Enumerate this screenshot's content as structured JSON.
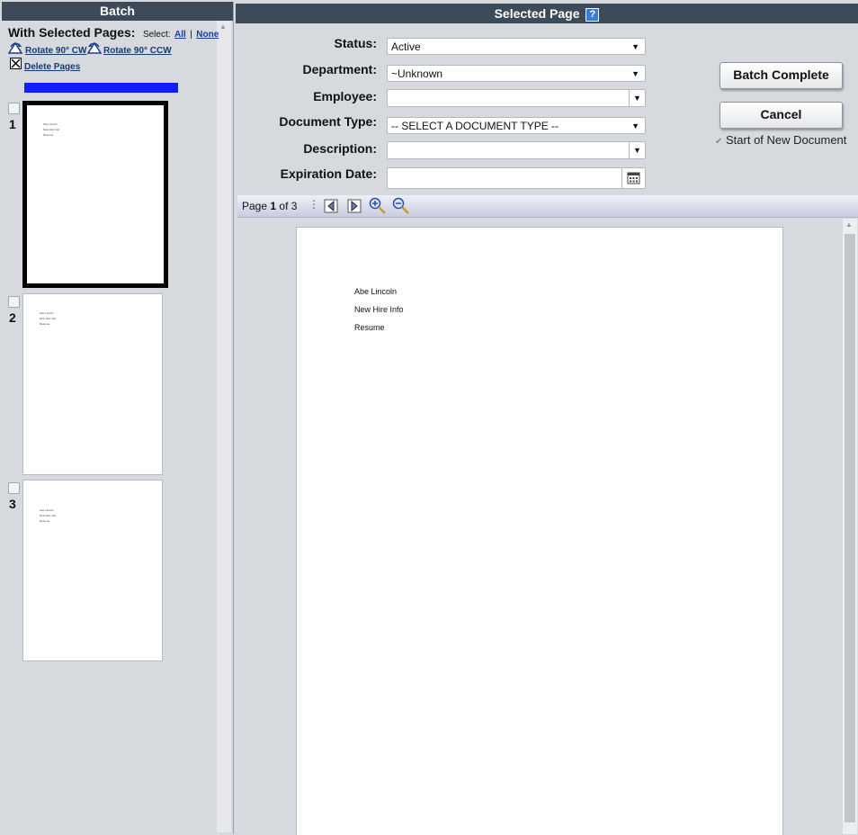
{
  "batch_panel": {
    "title": "Batch",
    "with_selected": "With Selected Pages:",
    "select_label": "Select:",
    "select_all": "All",
    "select_sep": "|",
    "select_none": "None",
    "rotate_cw": "Rotate 90° CW",
    "rotate_ccw": "Rotate 90° CCW",
    "delete_pages": "Delete Pages",
    "pages": [
      {
        "number": "1",
        "lines": [
          "Abe Lincoln",
          "New Hire Info",
          "Resume"
        ]
      },
      {
        "number": "2",
        "lines": [
          "Abe Lincoln",
          "New Hire Info",
          "Resume"
        ]
      },
      {
        "number": "3",
        "lines": [
          "Abe Lincoln",
          "New Hire Info",
          "Resume"
        ]
      }
    ]
  },
  "selected_page": {
    "title": "Selected Page",
    "help": "?",
    "fields": {
      "status_label": "Status:",
      "status_value": "Active",
      "department_label": "Department:",
      "department_value": "~Unknown",
      "employee_label": "Employee:",
      "employee_value": "",
      "document_type_label": "Document Type:",
      "document_type_value": "-- SELECT A DOCUMENT TYPE --",
      "description_label": "Description:",
      "description_value": "",
      "expiration_label": "Expiration Date:",
      "expiration_value": ""
    },
    "buttons": {
      "batch_complete": "Batch Complete",
      "cancel": "Cancel"
    },
    "start_new_document_label": "Start of New Document",
    "start_new_document_checked": true
  },
  "toolbar": {
    "page_prefix": "Page",
    "page_current": "1",
    "page_of": "of 3"
  },
  "document": {
    "lines": [
      "Abe Lincoln",
      "New Hire Info",
      "Resume"
    ]
  }
}
